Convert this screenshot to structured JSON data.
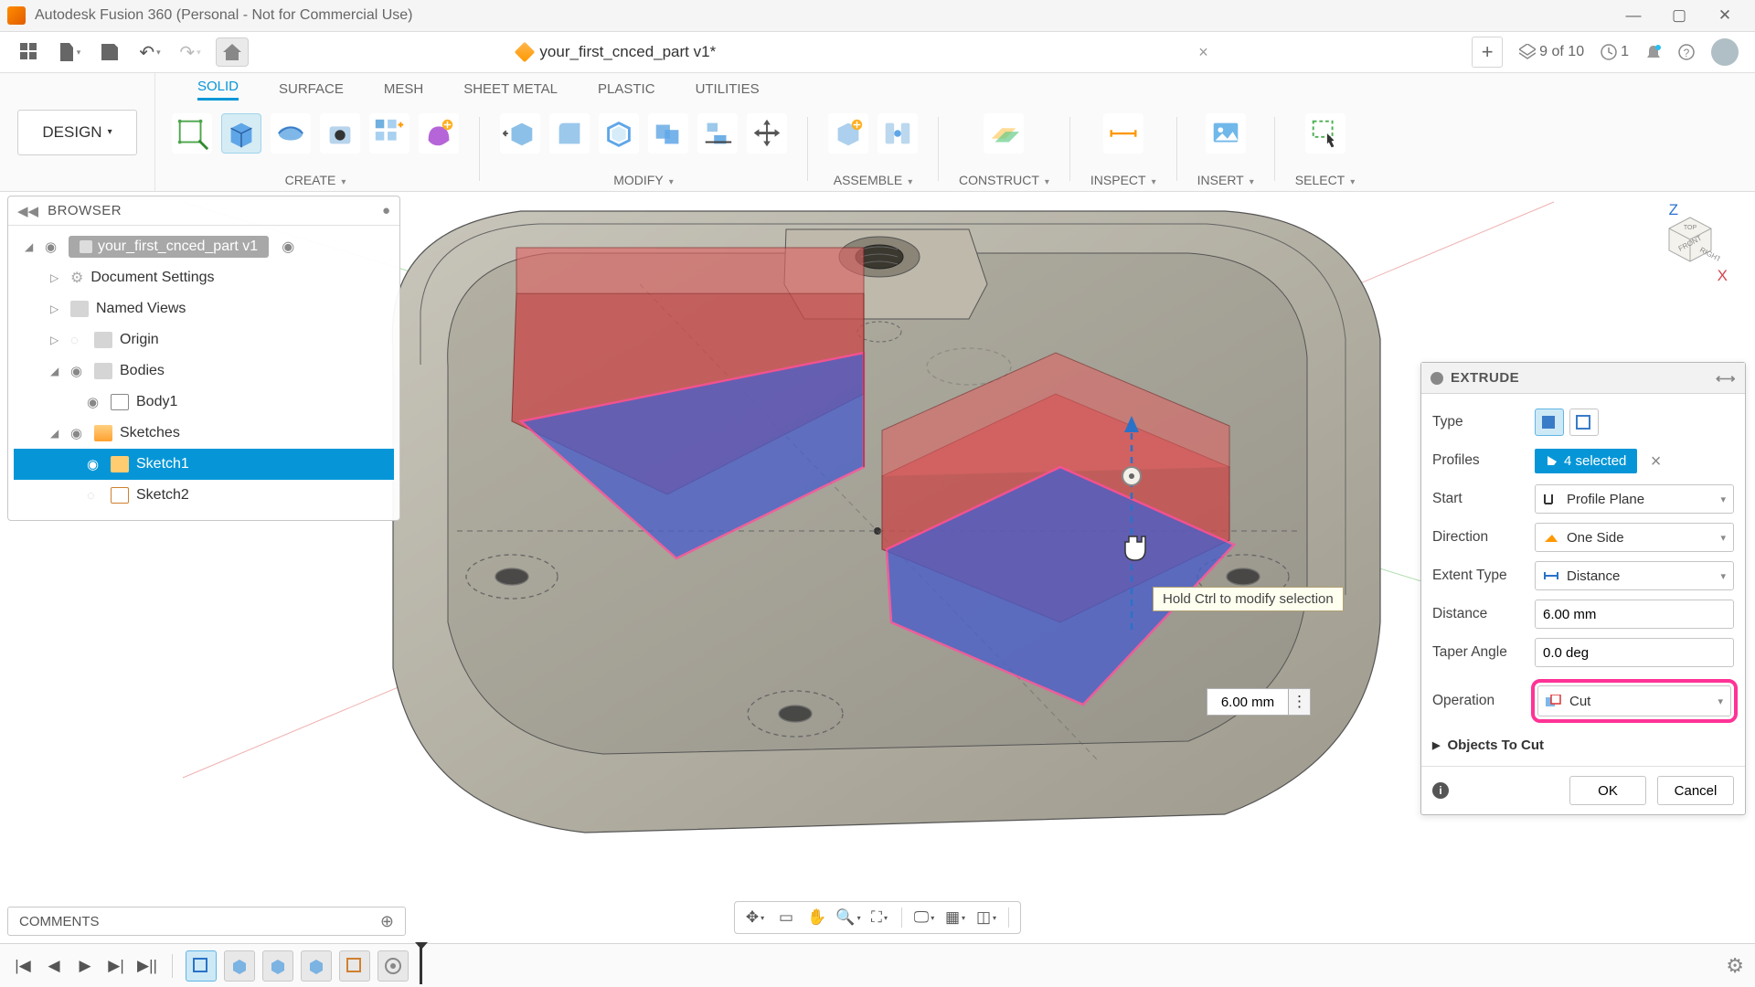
{
  "app": {
    "title": "Autodesk Fusion 360 (Personal - Not for Commercial Use)"
  },
  "quick": {
    "doc_tab_name": "your_first_cnced_part v1*",
    "ext_count": "9 of 10",
    "job_count": "1"
  },
  "workspace": {
    "name": "DESIGN"
  },
  "ribbon_tabs": {
    "solid": "SOLID",
    "surface": "SURFACE",
    "mesh": "MESH",
    "sheet_metal": "SHEET METAL",
    "plastic": "PLASTIC",
    "utilities": "UTILITIES"
  },
  "ribbon_groups": {
    "create": "CREATE",
    "modify": "MODIFY",
    "assemble": "ASSEMBLE",
    "construct": "CONSTRUCT",
    "inspect": "INSPECT",
    "insert": "INSERT",
    "select": "SELECT"
  },
  "browser": {
    "title": "BROWSER",
    "root": "your_first_cnced_part v1",
    "doc_settings": "Document Settings",
    "named_views": "Named Views",
    "origin": "Origin",
    "bodies": "Bodies",
    "body1": "Body1",
    "sketches": "Sketches",
    "sketch1": "Sketch1",
    "sketch2": "Sketch2"
  },
  "canvas": {
    "tooltip": "Hold Ctrl to modify selection",
    "dim_value": "6.00 mm"
  },
  "extrude": {
    "title": "EXTRUDE",
    "type_label": "Type",
    "profiles_label": "Profiles",
    "profiles_value": "4 selected",
    "start_label": "Start",
    "start_value": "Profile Plane",
    "direction_label": "Direction",
    "direction_value": "One Side",
    "extent_label": "Extent Type",
    "extent_value": "Distance",
    "distance_label": "Distance",
    "distance_value": "6.00 mm",
    "taper_label": "Taper Angle",
    "taper_value": "0.0 deg",
    "operation_label": "Operation",
    "operation_value": "Cut",
    "objects_to_cut": "Objects To Cut",
    "ok": "OK",
    "cancel": "Cancel"
  },
  "comments": {
    "title": "COMMENTS"
  }
}
